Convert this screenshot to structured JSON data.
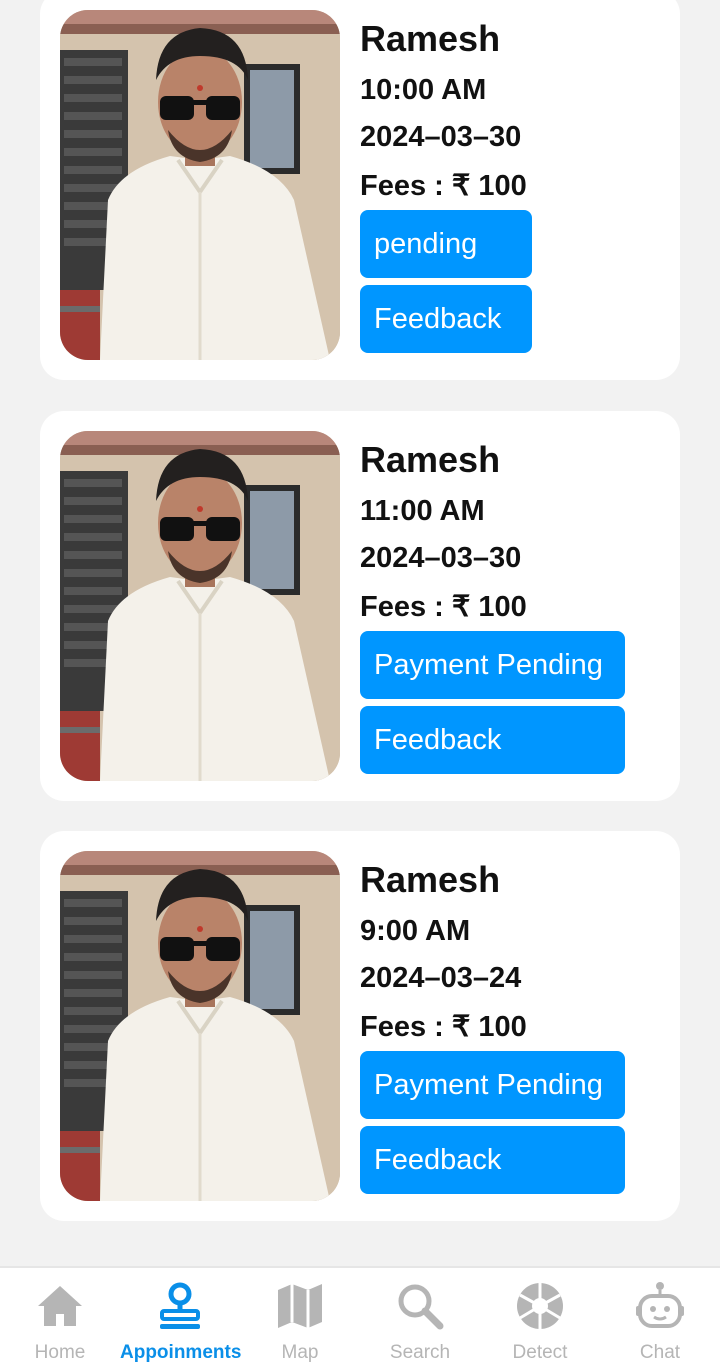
{
  "appointments": [
    {
      "doctor_name": "Ramesh",
      "time": "10:00 AM",
      "date": "2024–03–30",
      "fees": "Fees : ₹ 100",
      "status_label": "pending",
      "feedback_label": "Feedback"
    },
    {
      "doctor_name": "Ramesh",
      "time": "11:00 AM",
      "date": "2024–03–30",
      "fees": "Fees : ₹ 100",
      "status_label": "Payment Pending",
      "feedback_label": "Feedback"
    },
    {
      "doctor_name": "Ramesh",
      "time": "9:00 AM",
      "date": "2024–03–24",
      "fees": "Fees : ₹ 100",
      "status_label": "Payment Pending",
      "feedback_label": "Feedback"
    }
  ],
  "bottom_nav": {
    "active": "Appoinments",
    "items": [
      {
        "label": "Home",
        "icon": "home-icon"
      },
      {
        "label": "Appoinments",
        "icon": "appointment-pin-icon"
      },
      {
        "label": "Map",
        "icon": "map-icon"
      },
      {
        "label": "Search",
        "icon": "search-icon"
      },
      {
        "label": "Detect",
        "icon": "aperture-icon"
      },
      {
        "label": "Chat",
        "icon": "robot-icon"
      }
    ]
  },
  "colors": {
    "accent": "#0096ff",
    "active_nav": "#0a8fe8",
    "inactive_nav": "#b5b5b5",
    "background": "#f2f2f2",
    "card": "#ffffff"
  }
}
